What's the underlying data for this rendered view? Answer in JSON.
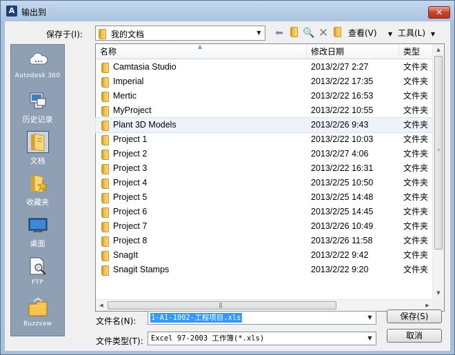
{
  "window": {
    "title": "输出到",
    "app_icon_glyph": "A",
    "close_glyph": "✕"
  },
  "save_in": {
    "label": "保存于(I):",
    "value": "我的文档"
  },
  "toolbar": {
    "views_label": "查看(V)",
    "tools_label": "工具(L)"
  },
  "places": [
    {
      "label": "Autodesk 360",
      "icon": "cloud-icon"
    },
    {
      "label": "历史记录",
      "icon": "history-icon"
    },
    {
      "label": "文档",
      "icon": "documents-icon",
      "selected": true
    },
    {
      "label": "收藏夹",
      "icon": "favorites-icon"
    },
    {
      "label": "桌面",
      "icon": "desktop-icon"
    },
    {
      "label": "FTP",
      "icon": "ftp-icon"
    },
    {
      "label": "Buzzsaw",
      "icon": "buzzsaw-icon"
    }
  ],
  "columns": {
    "name": "名称",
    "date": "修改日期",
    "type": "类型"
  },
  "files": [
    {
      "name": "Camtasia Studio",
      "date": "2013/2/27 2:27",
      "type": "文件夹"
    },
    {
      "name": "Imperial",
      "date": "2013/2/22 17:35",
      "type": "文件夹"
    },
    {
      "name": "Mertic",
      "date": "2013/2/22 16:53",
      "type": "文件夹"
    },
    {
      "name": "MyProject",
      "date": "2013/2/22 10:55",
      "type": "文件夹"
    },
    {
      "name": "Plant 3D Models",
      "date": "2013/2/26 9:43",
      "type": "文件夹"
    },
    {
      "name": "Project 1",
      "date": "2013/2/22 10:03",
      "type": "文件夹"
    },
    {
      "name": "Project 2",
      "date": "2013/2/27 4:06",
      "type": "文件夹"
    },
    {
      "name": "Project 3",
      "date": "2013/2/22 16:31",
      "type": "文件夹"
    },
    {
      "name": "Project 4",
      "date": "2013/2/25 10:50",
      "type": "文件夹"
    },
    {
      "name": "Project 5",
      "date": "2013/2/25 14:48",
      "type": "文件夹"
    },
    {
      "name": "Project 6",
      "date": "2013/2/25 14:45",
      "type": "文件夹"
    },
    {
      "name": "Project 7",
      "date": "2013/2/26 10:49",
      "type": "文件夹"
    },
    {
      "name": "Project 8",
      "date": "2013/2/26 11:58",
      "type": "文件夹"
    },
    {
      "name": "SnagIt",
      "date": "2013/2/22 9:42",
      "type": "文件夹"
    },
    {
      "name": "Snagit Stamps",
      "date": "2013/2/22 9:20",
      "type": "文件夹"
    }
  ],
  "highlighted_row": 4,
  "file_name": {
    "label": "文件名(N):",
    "value": "1-A1-1002-工程项目.xls"
  },
  "file_type": {
    "label": "文件类型(T):",
    "value": "Excel 97-2003 工作簿(*.xls)"
  },
  "buttons": {
    "save": "保存(S)",
    "cancel": "取消"
  }
}
